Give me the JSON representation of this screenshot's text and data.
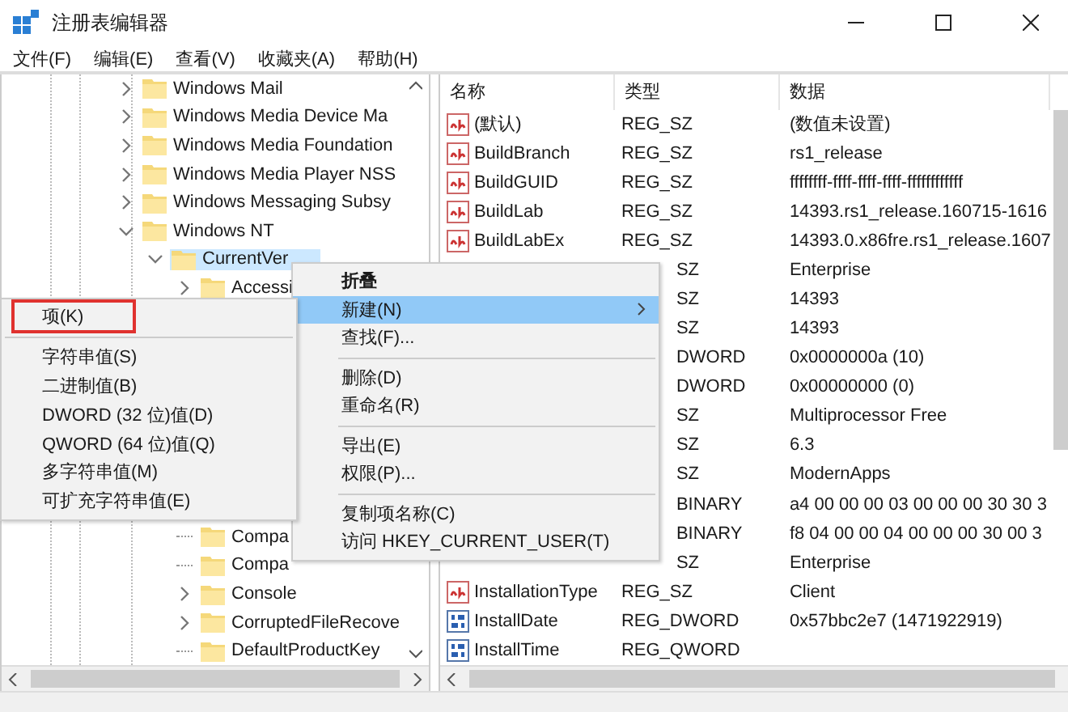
{
  "window": {
    "title": "注册表编辑器"
  },
  "menu_bar": [
    "文件(F)",
    "编辑(E)",
    "查看(V)",
    "收藏夹(A)",
    "帮助(H)"
  ],
  "tree": {
    "items": [
      {
        "label": "Windows Mail",
        "expanded": false,
        "selected": false
      },
      {
        "label": "Windows Media Device Ma",
        "expanded": false,
        "selected": false
      },
      {
        "label": "Windows Media Foundation",
        "expanded": false,
        "selected": false
      },
      {
        "label": "Windows Media Player NSS",
        "expanded": false,
        "selected": false
      },
      {
        "label": "Windows Messaging Subsy",
        "expanded": false,
        "selected": false
      },
      {
        "label": "Windows NT",
        "expanded": true,
        "selected": false,
        "children": [
          {
            "label": "CurrentVer",
            "expanded": true,
            "selected": true,
            "children": [
              {
                "label": "Accessi",
                "expanded": false,
                "selected": false
              },
              {
                "label": "Compa",
                "selected": false
              },
              {
                "label": "Compa",
                "selected": false
              },
              {
                "label": "Console",
                "expanded": false,
                "selected": false
              },
              {
                "label": "CorruptedFileRecove",
                "expanded": false,
                "selected": false
              },
              {
                "label": "DefaultProductKey",
                "selected": false
              }
            ]
          }
        ]
      }
    ]
  },
  "table": {
    "columns": [
      "名称",
      "类型",
      "数据"
    ],
    "rows": [
      {
        "kind": "string",
        "name": "(默认)",
        "type": "REG_SZ",
        "data": "(数值未设置)"
      },
      {
        "kind": "string",
        "name": "BuildBranch",
        "type": "REG_SZ",
        "data": "rs1_release"
      },
      {
        "kind": "string",
        "name": "BuildGUID",
        "type": "REG_SZ",
        "data": "ffffffff-ffff-ffff-ffff-ffffffffffff"
      },
      {
        "kind": "string",
        "name": "BuildLab",
        "type": "REG_SZ",
        "data": "14393.rs1_release.160715-1616"
      },
      {
        "kind": "string",
        "name": "BuildLabEx",
        "type": "REG_SZ",
        "data": "14393.0.x86fre.rs1_release.1607"
      },
      {
        "type": "SZ",
        "data": "Enterprise"
      },
      {
        "type": "SZ",
        "data": "14393"
      },
      {
        "type": "SZ",
        "data": "14393"
      },
      {
        "type": "DWORD",
        "data": "0x0000000a (10)"
      },
      {
        "type": "DWORD",
        "data": "0x00000000 (0)"
      },
      {
        "type": "SZ",
        "data": "Multiprocessor Free"
      },
      {
        "type": "SZ",
        "data": "6.3"
      },
      {
        "type": "SZ",
        "data": "ModernApps"
      },
      {
        "type": "BINARY",
        "data": "a4 00 00 00 03 00 00 00 30 30 3"
      },
      {
        "type": "BINARY",
        "data": "f8 04 00 00 04 00 00 00 30 00 3"
      },
      {
        "type": "SZ",
        "data": "Enterprise"
      },
      {
        "kind": "string",
        "name": "InstallationType",
        "type": "REG_SZ",
        "data": "Client"
      },
      {
        "kind": "binary",
        "name": "InstallDate",
        "type": "REG_DWORD",
        "data": "0x57bbc2e7 (1471922919)"
      },
      {
        "kind": "binary",
        "name": "InstallTime",
        "type": "REG_QWORD"
      }
    ]
  },
  "context_menu": {
    "items": [
      {
        "kind": "item",
        "label": "折叠",
        "default": true,
        "selected": false
      },
      {
        "kind": "item",
        "label": "新建(N)",
        "selected": true,
        "submenu": true
      },
      {
        "kind": "item",
        "label": "查找(F)...",
        "selected": false
      },
      {
        "kind": "separator"
      },
      {
        "kind": "item",
        "label": "删除(D)",
        "selected": false
      },
      {
        "kind": "item",
        "label": "重命名(R)",
        "selected": false
      },
      {
        "kind": "separator"
      },
      {
        "kind": "item",
        "label": "导出(E)",
        "selected": false
      },
      {
        "kind": "item",
        "label": "权限(P)...",
        "selected": false
      },
      {
        "kind": "separator"
      },
      {
        "kind": "item",
        "label": "复制项名称(C)",
        "selected": false
      },
      {
        "kind": "item",
        "label": "访问 HKEY_CURRENT_USER(T)",
        "selected": false
      }
    ]
  },
  "submenu": {
    "items": [
      {
        "kind": "item",
        "label": "项(K)",
        "outlined": true
      },
      {
        "kind": "separator"
      },
      {
        "kind": "item",
        "label": "字符串值(S)",
        "outlined": false
      },
      {
        "kind": "item",
        "label": "二进制值(B)",
        "outlined": false
      },
      {
        "kind": "item",
        "label": "DWORD (32 位)值(D)",
        "outlined": false
      },
      {
        "kind": "item",
        "label": "QWORD (64 位)值(Q)",
        "outlined": false
      },
      {
        "kind": "item",
        "label": "多字符串值(M)",
        "outlined": false
      },
      {
        "kind": "item",
        "label": "可扩充字符串值(E)",
        "outlined": false
      }
    ]
  }
}
